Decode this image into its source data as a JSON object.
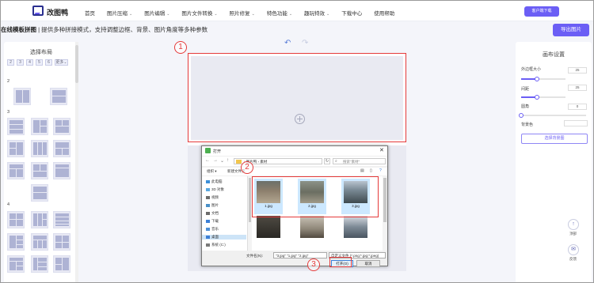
{
  "header": {
    "brand": "改图鸭",
    "nav": [
      {
        "label": "首页",
        "caret": false
      },
      {
        "label": "图片压缩",
        "caret": true
      },
      {
        "label": "图片编辑",
        "caret": true
      },
      {
        "label": "图片文件转换",
        "caret": true
      },
      {
        "label": "照片修复",
        "caret": true
      },
      {
        "label": "特色功能",
        "caret": true
      },
      {
        "label": "趣玩特效",
        "caret": true
      },
      {
        "label": "下载中心",
        "caret": false
      },
      {
        "label": "使用帮助",
        "caret": false
      }
    ],
    "client_button": "客户端下载"
  },
  "page": {
    "title_bold": "在线模板拼图",
    "title_rest": " | 提供多种拼接模式，支持调整边框、背景、图片角度等多种参数",
    "export_button": "导出图片"
  },
  "left_panel": {
    "title": "选择布局",
    "tabs": [
      "2",
      "3",
      "4",
      "5",
      "6",
      "更多⌄"
    ],
    "groups": [
      "2",
      "3",
      "4"
    ]
  },
  "canvas": {
    "undo": "↶",
    "redo": "↷"
  },
  "annotations": {
    "one": "1",
    "two": "2",
    "three": "3"
  },
  "dialog": {
    "title": "打开",
    "path": "› 图片鸭 › 素材",
    "search_placeholder": "搜索\"素材\"",
    "toolbar_organize": "组织 ▾",
    "toolbar_new_folder": "新建文件夹",
    "tree": [
      {
        "label": "此电脑",
        "color": "#3c8fd9"
      },
      {
        "label": "3D 对象",
        "color": "#59a7e0"
      },
      {
        "label": "视频",
        "color": "#6c6c6c"
      },
      {
        "label": "图片",
        "color": "#4a90c8"
      },
      {
        "label": "文档",
        "color": "#6c6c6c"
      },
      {
        "label": "下载",
        "color": "#3c7fd6"
      },
      {
        "label": "音乐",
        "color": "#4d8fd6"
      },
      {
        "label": "桌面",
        "color": "#3c7fd6"
      },
      {
        "label": "系统 (C:)",
        "color": "#7a7a7a"
      }
    ],
    "files": [
      {
        "label": "1.jpg",
        "selected": true
      },
      {
        "label": "2.jpg",
        "selected": true
      },
      {
        "label": "3.jpg",
        "selected": true
      },
      {
        "label": "",
        "selected": false
      },
      {
        "label": "",
        "selected": false
      },
      {
        "label": "",
        "selected": false
      }
    ],
    "filename_label": "文件名(N):",
    "filename_value": "\"3.jpg\" \"1.jpg\" \"2.jpg\"",
    "filetype_value": "自定义文件 (*.png;*.jpg;*.jpeg)",
    "open_button": "打开(O)",
    "cancel_button": "取消"
  },
  "right_panel": {
    "title": "画布设置",
    "outer_border_label": "外边框大小",
    "outer_border_value": "25",
    "outer_border_level": 0.35,
    "spacing_label": "间距",
    "spacing_value": "25",
    "spacing_level": 0.35,
    "radius_label": "圆角",
    "radius_value": "0",
    "radius_level": 0.0,
    "bg_color_label": "背景色",
    "bg_button": "选择背景图",
    "top_label": "顶部",
    "feedback_label": "反馈"
  },
  "colors": {
    "accent": "#6b5ef5",
    "annotation": "#e53a3a"
  }
}
